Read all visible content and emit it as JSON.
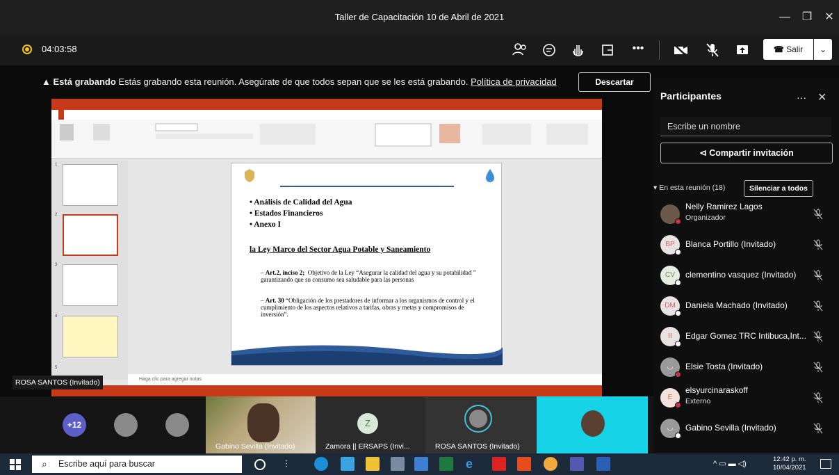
{
  "window": {
    "title": "Taller de Capacitación 10 de Abril de 2021"
  },
  "toolbar": {
    "timer": "04:03:58",
    "leave_label": "Salir"
  },
  "banner": {
    "bold": "Está grabando",
    "text": "Estás grabando esta reunión. Asegúrate de que todos sepan que se les está grabando.",
    "link": "Política de privacidad",
    "discard": "Descartar"
  },
  "slide": {
    "bullets": [
      "Análisis de Calidad del Agua",
      "Estados Financieros",
      "Anexo I"
    ],
    "law_title": "la Ley Marco del Sector Agua Potable y Saneamiento",
    "art1_bold": "Art.2, inciso 2;",
    "art1_text": "Objetivo de la Ley “Asegurar la calidad del agua y su potabilidad ” garantizando que su consumo sea saludable para las personas",
    "art2_bold": "Art. 30",
    "art2_text": "“Obligación de los prestadores de informar a los organismos de control y el cumplimiento de los aspectos relativos a tarifas, obras y metas y compromisos de inversión”.",
    "notes_placeholder": "Haga clic para agregar notas"
  },
  "presenter_label": "ROSA SANTOS (Invitado)",
  "panel": {
    "title": "Participantes",
    "search_placeholder": "Escribe un nombre",
    "share_label": "Compartir invitación",
    "in_meeting": "En esta reunión (18)",
    "mute_all": "Silenciar a todos",
    "participants": [
      {
        "name": "Nelly Ramirez Lagos",
        "role": "Organizador",
        "initials": ""
      },
      {
        "name": "Blanca Portillo (Invitado)",
        "role": "",
        "initials": "BP"
      },
      {
        "name": "clementino vasquez (Invitado)",
        "role": "",
        "initials": "CV"
      },
      {
        "name": "Daniela Machado (Invitado)",
        "role": "",
        "initials": "DM"
      },
      {
        "name": "Edgar Gomez TRC Intibuca,Int...",
        "role": "",
        "initials": "II"
      },
      {
        "name": "Elsie Tosta (Invitado)",
        "role": "",
        "initials": ""
      },
      {
        "name": "elsyurcinaraskoff",
        "role": "Externo",
        "initials": "E"
      },
      {
        "name": "Gabino Sevilla (Invitado)",
        "role": "",
        "initials": ""
      }
    ]
  },
  "strip": {
    "more_count": "+12",
    "video1_label": "Gabino Sevilla (Invitado)",
    "video2_label": "Zamora || ERSAPS (Invi...",
    "video2_initial": "Z",
    "video3_label": "ROSA SANTOS (Invitado)"
  },
  "taskbar": {
    "search_placeholder": "Escribe aquí para buscar",
    "time": "12:42 p. m.",
    "date": "10/04/2021"
  }
}
